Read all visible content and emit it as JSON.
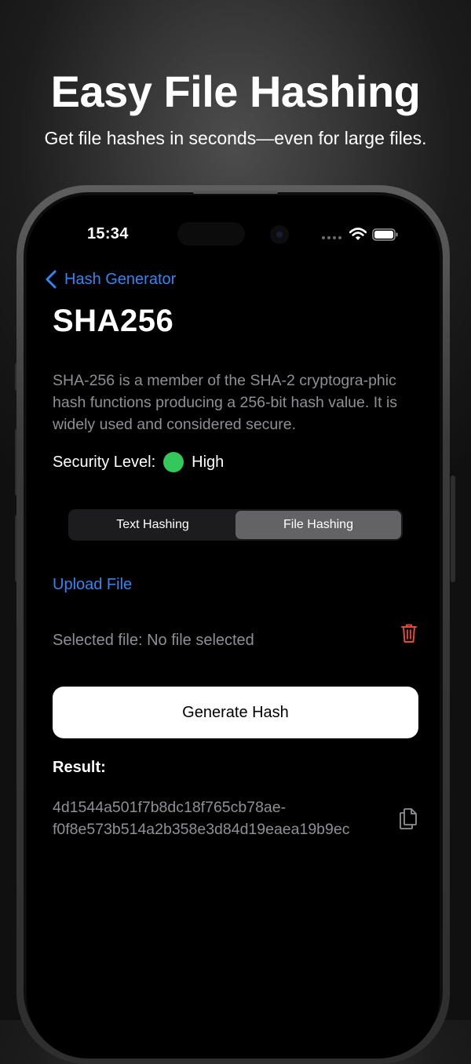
{
  "promo": {
    "headline": "Easy File Hashing",
    "subheadline": "Get file hashes in seconds—even for large files."
  },
  "status_bar": {
    "time": "15:34",
    "icons": [
      "signal-dots-icon",
      "wifi-icon",
      "battery-icon"
    ]
  },
  "nav": {
    "back_label": "Hash Generator",
    "back_icon": "chevron-left-icon"
  },
  "page": {
    "title": "SHA256",
    "description": "SHA-256 is a member of the SHA-2 cryptogra-phic hash functions producing a 256-bit hash value. It is widely used and considered secure.",
    "security_label": "Security Level:",
    "security_value": "High",
    "security_color": "#34c759"
  },
  "tabs": [
    {
      "label": "Text Hashing",
      "selected": false
    },
    {
      "label": "File Hashing",
      "selected": true
    }
  ],
  "file": {
    "upload_label": "Upload File",
    "selected_text": "Selected file: No file selected",
    "delete_icon": "trash-icon"
  },
  "action": {
    "generate_label": "Generate Hash"
  },
  "result": {
    "label": "Result:",
    "hash_line1": "4d1544a501f7b8dc18f765cb78ae-",
    "hash_line2": "f0f8e573b514a2b358e3d84d19eaea19b9ec",
    "copy_icon": "copy-icon"
  },
  "colors": {
    "accent": "#2f86f4",
    "destructive": "#e5483d",
    "secondary_text": "#8f8f94",
    "background": "#000000"
  }
}
